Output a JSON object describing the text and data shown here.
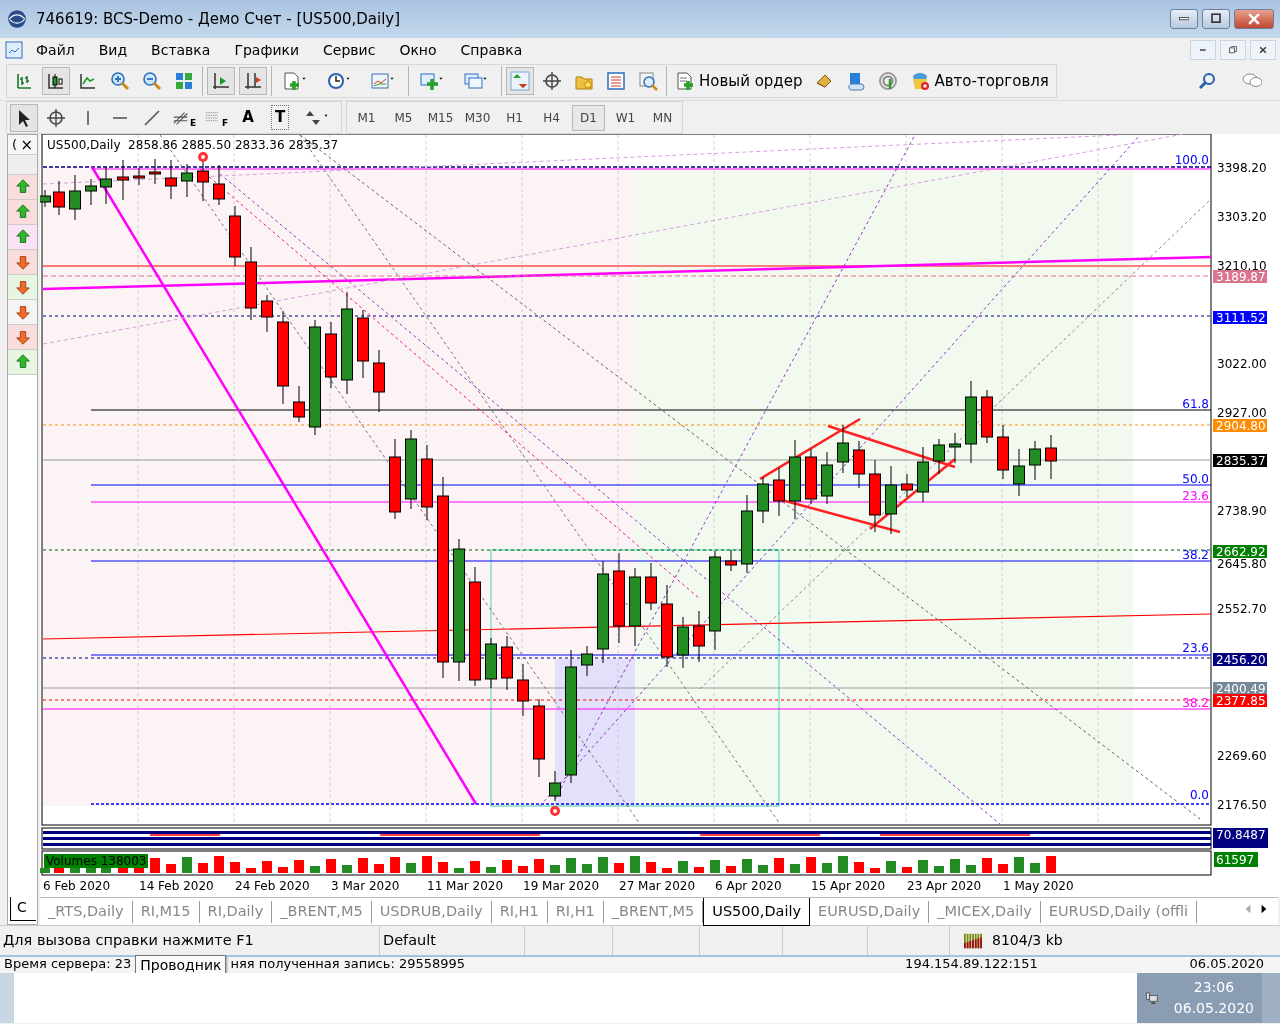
{
  "window": {
    "title": "746619: BCS-Demo - Демо Счет - [US500,Daily]"
  },
  "menu": [
    "Файл",
    "Вид",
    "Вставка",
    "Графики",
    "Сервис",
    "Окно",
    "Справка"
  ],
  "chart_type_buttons": [
    {
      "selected": false
    },
    {
      "selected": true
    },
    {
      "selected": false
    }
  ],
  "trading_buttons": [
    "Новый ордер",
    "Авто-торговля"
  ],
  "drawing_tools": [
    {
      "kind": "cursor",
      "selected": true
    },
    {
      "kind": "crosshair",
      "selected": false
    },
    {
      "kind": "vline",
      "selected": false
    },
    {
      "kind": "hline",
      "selected": false
    },
    {
      "kind": "trend",
      "selected": false
    },
    {
      "kind": "fibo",
      "label": "E",
      "selected": false
    },
    {
      "kind": "grid",
      "label": "F",
      "selected": false
    },
    {
      "kind": "text",
      "label": "A",
      "selected": false
    },
    {
      "kind": "textlabel",
      "label": "T",
      "selected": false
    },
    {
      "kind": "arrows",
      "selected": false
    }
  ],
  "timeframes": [
    {
      "label": "M1",
      "selected": false
    },
    {
      "label": "M5",
      "selected": false
    },
    {
      "label": "M15",
      "selected": false
    },
    {
      "label": "M30",
      "selected": false
    },
    {
      "label": "H1",
      "selected": false
    },
    {
      "label": "H4",
      "selected": false
    },
    {
      "label": "D1",
      "selected": true
    },
    {
      "label": "W1",
      "selected": false
    },
    {
      "label": "MN",
      "selected": false
    }
  ],
  "side_panel": {
    "header": "(",
    "close": "×",
    "footer": "C",
    "signals": [
      {
        "kind": "up",
        "color": "#f9dcdc"
      },
      {
        "kind": "up",
        "color": "#f9dcdc"
      },
      {
        "kind": "up",
        "color": "#fbe3f6"
      },
      {
        "kind": "down",
        "color": "#f9dcdc"
      },
      {
        "kind": "down",
        "color": "#e6f6e1"
      },
      {
        "kind": "down",
        "color": "#f4f4f4"
      },
      {
        "kind": "down",
        "color": "#f9dcdc"
      },
      {
        "kind": "up",
        "color": "#e6f6e1"
      }
    ]
  },
  "chart": {
    "header": "US500,Daily  2858.86 2885.50 2833.36 2835.37",
    "price_labels": [
      "3398.20",
      "3303.20",
      "3210.10",
      "3022.00",
      "2927.00",
      "2738.90",
      "2645.80",
      "2552.70",
      "2269.60",
      "2176.50"
    ],
    "price_badges": [
      {
        "text": "3189.87",
        "color": "#d9748f"
      },
      {
        "text": "3111.52",
        "color": "#0000ff"
      },
      {
        "text": "2904.80",
        "color": "#ff8c00"
      },
      {
        "text": "2835.37",
        "color": "#000000"
      },
      {
        "text": "2662.92",
        "color": "#008000"
      },
      {
        "text": "2456.20",
        "color": "#000080"
      },
      {
        "text": "2400.49",
        "color": "#778899"
      },
      {
        "text": "2377.85",
        "color": "#ff0000"
      }
    ],
    "fib_labels": [
      {
        "text": "100.0",
        "color": "#0000ff"
      },
      {
        "text": "61.8",
        "color": "#0000ff"
      },
      {
        "text": "50.0",
        "color": "#0000ff"
      },
      {
        "text": "23.6",
        "color": "#ff00ff"
      },
      {
        "text": "38.2",
        "color": "#0000ff"
      },
      {
        "text": "23.6",
        "color": "#0000ff"
      },
      {
        "text": "38.2",
        "color": "#ff00ff"
      },
      {
        "text": "0.0",
        "color": "#0000ff"
      }
    ],
    "indicator_badge": "70.8487",
    "volumes_label": "Volumes 138003",
    "volumes_badge": "61597",
    "dates": [
      "6 Feb 2020",
      "14 Feb 2020",
      "24 Feb 2020",
      "3 Mar 2020",
      "11 Mar 2020",
      "19 Mar 2020",
      "27 Mar 2020",
      "6 Apr 2020",
      "15 Apr 2020",
      "23 Apr 2020",
      "1 May 2020"
    ]
  },
  "tabs": [
    {
      "label": "_RTS,Daily",
      "selected": false
    },
    {
      "label": "RI,M15",
      "selected": false
    },
    {
      "label": "RI,Daily",
      "selected": false
    },
    {
      "label": "_BRENT,M5",
      "selected": false
    },
    {
      "label": "USDRUB,Daily",
      "selected": false
    },
    {
      "label": "RI,H1",
      "selected": false
    },
    {
      "label": "RI,H1",
      "selected": false
    },
    {
      "label": "_BRENT,M5",
      "selected": false
    },
    {
      "label": "US500,Daily",
      "selected": true
    },
    {
      "label": "EURUSD,Daily",
      "selected": false
    },
    {
      "label": "_MICEX,Daily",
      "selected": false
    },
    {
      "label": "EURUSD,Daily (offli",
      "selected": false
    }
  ],
  "status_bar": {
    "help": "Для вызова справки нажмите F1",
    "profile": "Default",
    "traffic": "8104/3 kb"
  },
  "back_window": {
    "left": "Время сервера: 23",
    "tooltip": "Проводник",
    "middle": "няя полученная запись: 29558995",
    "address": "194.154.89.122:151",
    "date": "06.05.2020"
  },
  "taskbar": {
    "time": "23:06",
    "date": "06.05.2020"
  }
}
